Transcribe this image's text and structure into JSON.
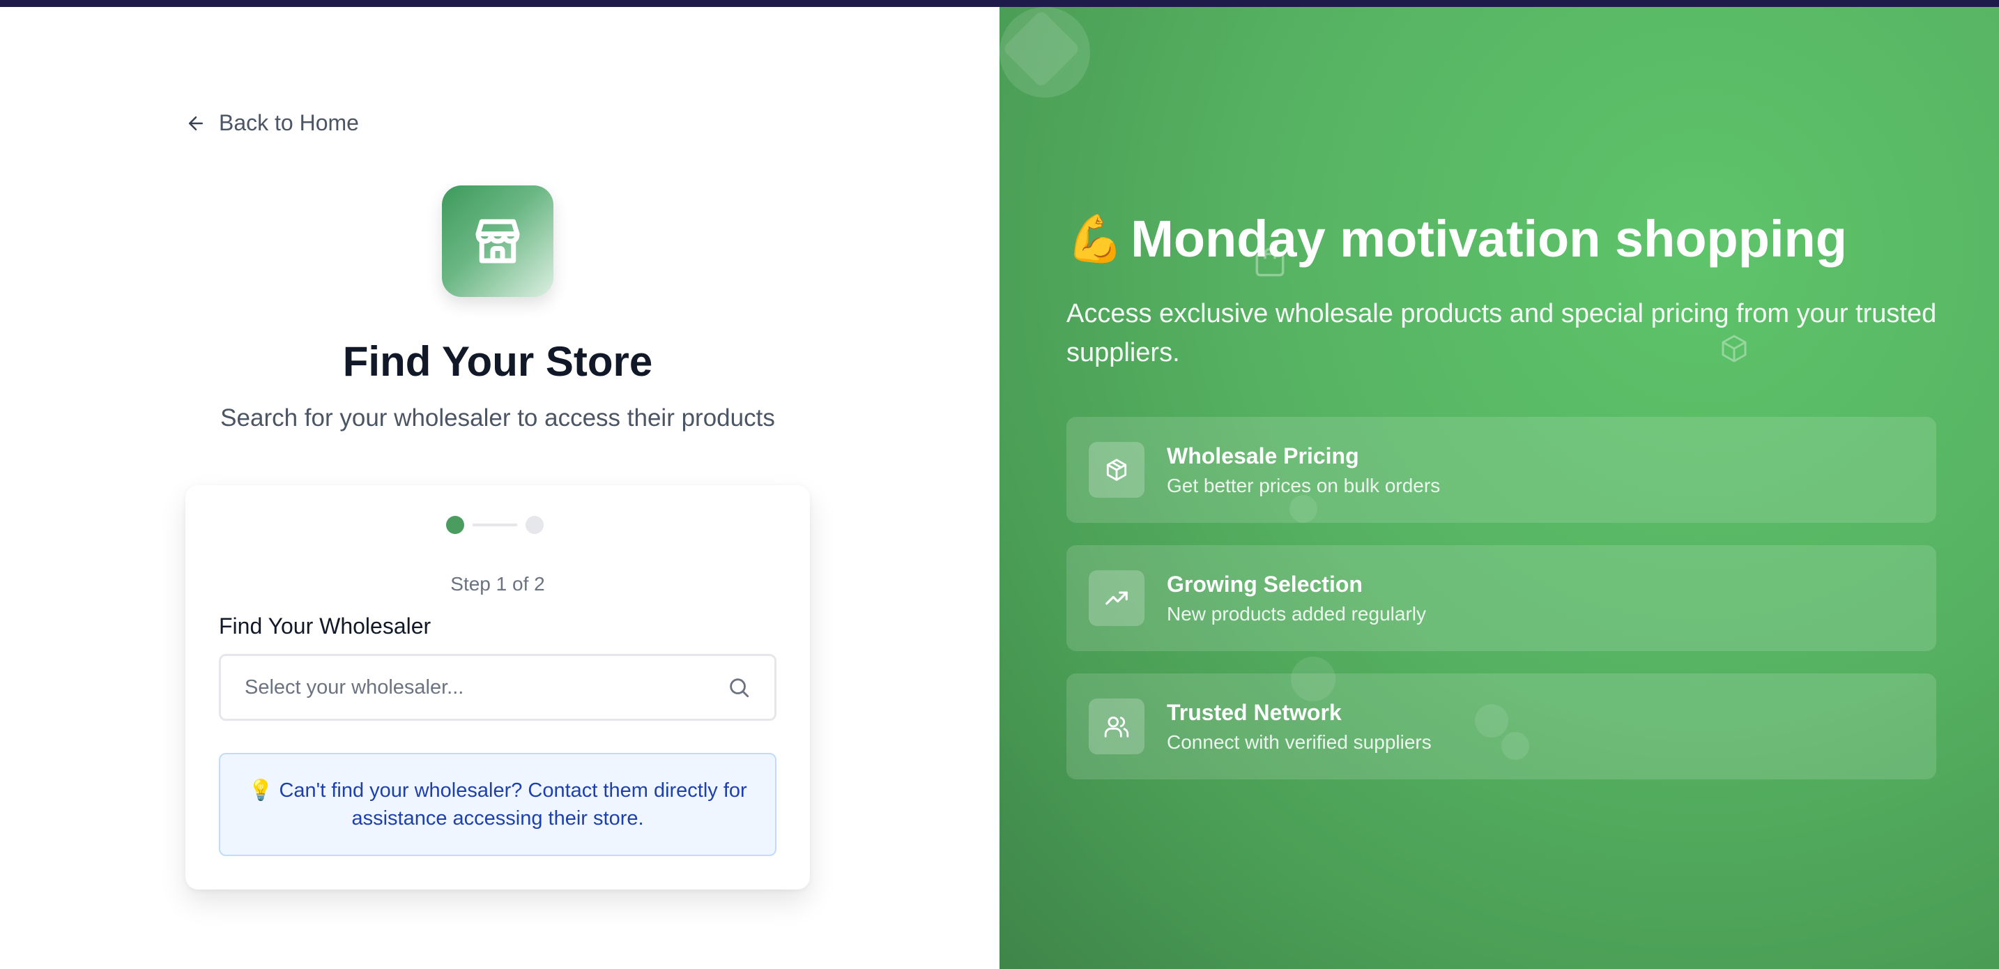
{
  "back_link": {
    "label": "Back to Home"
  },
  "header": {
    "title": "Find Your Store",
    "subtitle": "Search for your wholesaler to access their products"
  },
  "stepper": {
    "current": 1,
    "total": 2,
    "text": "Step 1 of 2"
  },
  "wholesaler_field": {
    "label": "Find Your Wholesaler",
    "placeholder": "Select your wholesaler..."
  },
  "hint": {
    "icon": "lightbulb-icon",
    "text": "💡 Can't find your wholesaler? Contact them directly for assistance accessing their store."
  },
  "promo": {
    "emoji": "💪",
    "headline": "Monday motivation shopping",
    "description": "Access exclusive wholesale products and special pricing from your trusted suppliers.",
    "features": [
      {
        "icon": "package-icon",
        "title": "Wholesale Pricing",
        "description": "Get better prices on bulk orders"
      },
      {
        "icon": "trending-up-icon",
        "title": "Growing Selection",
        "description": "New products added regularly"
      },
      {
        "icon": "users-icon",
        "title": "Trusted Network",
        "description": "Connect with verified suppliers"
      }
    ]
  },
  "colors": {
    "brand_green": "#4a9d5f",
    "panel_green": "#56b262",
    "hint_bg": "#eff6ff",
    "hint_text": "#1e40af",
    "title_text": "#111827"
  }
}
